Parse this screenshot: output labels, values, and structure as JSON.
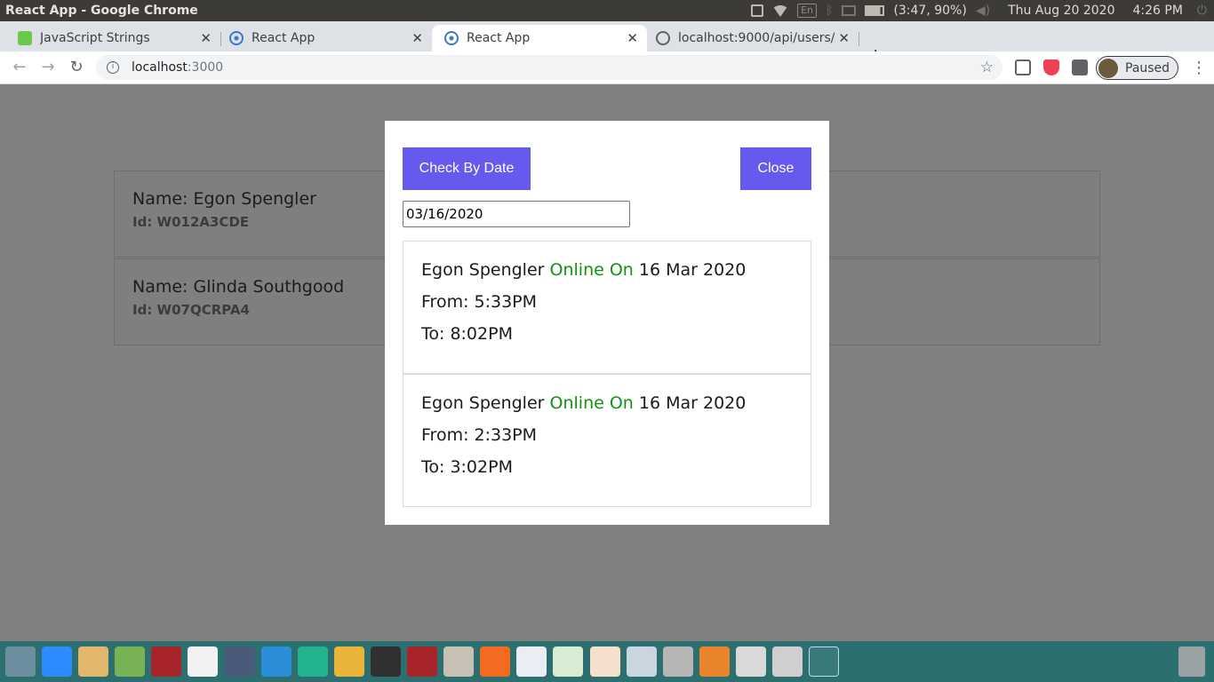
{
  "system_bar": {
    "window_title": "React App - Google Chrome",
    "language": "En",
    "battery": "(3:47, 90%)",
    "date": "Thu Aug 20 2020",
    "time": "4:26 PM"
  },
  "browser": {
    "tabs": [
      {
        "label": "JavaScript Strings",
        "icon": "js-favicon",
        "active": false
      },
      {
        "label": "React App",
        "icon": "react-favicon",
        "active": false
      },
      {
        "label": "React App",
        "icon": "react-favicon",
        "active": true
      },
      {
        "label": "localhost:9000/api/users/",
        "icon": "globe-icon",
        "active": false
      }
    ],
    "address": {
      "host": "localhost",
      "port": ":3000"
    },
    "profile_label": "Paused"
  },
  "users": [
    {
      "name": "Name: Egon Spengler",
      "id": "Id: W012A3CDE"
    },
    {
      "name": "Name: Glinda Southgood",
      "id": "Id: W07QCRPA4"
    }
  ],
  "modal": {
    "check_button": "Check By Date",
    "close_button": "Close",
    "date_value": "03/16/2020",
    "entries": [
      {
        "name": "Egon Spengler",
        "status": "Online On",
        "date": "16 Mar 2020",
        "from": "From: 5:33PM",
        "to": "To: 8:02PM"
      },
      {
        "name": "Egon Spengler",
        "status": "Online On",
        "date": "16 Mar 2020",
        "from": "From: 2:33PM",
        "to": "To: 3:02PM"
      }
    ]
  },
  "colors": {
    "accent": "#6559ee",
    "online": "#129312",
    "overlay": "#808080"
  }
}
